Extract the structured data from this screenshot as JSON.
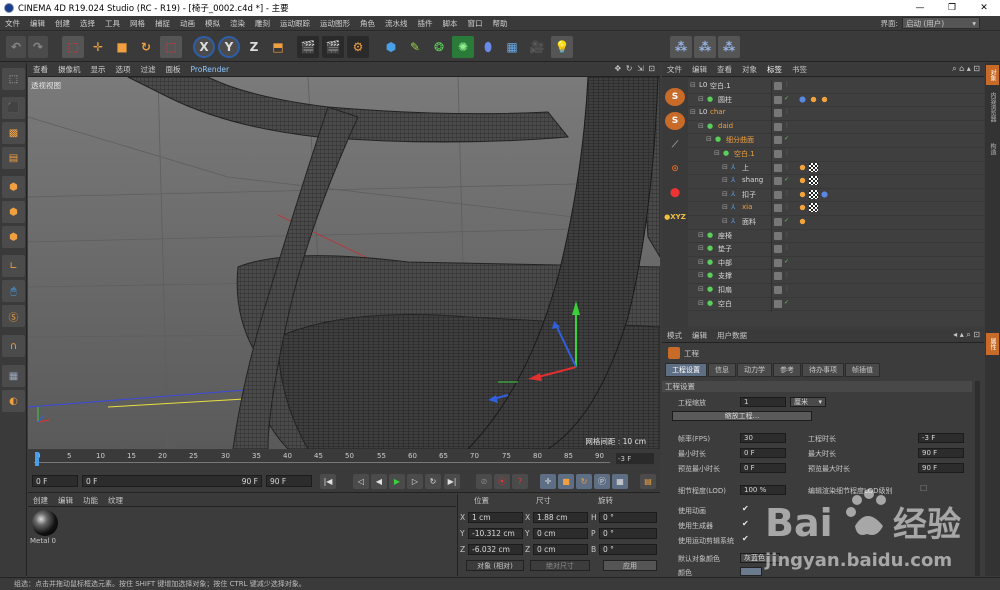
{
  "titlebar": {
    "title": "CINEMA 4D R19.024 Studio (RC - R19) - [椅子_0002.c4d *] - 主要",
    "min": "—",
    "max": "❐",
    "close": "✕"
  },
  "menubar": {
    "items": [
      "文件",
      "编辑",
      "创建",
      "选择",
      "工具",
      "网格",
      "捕捉",
      "动画",
      "模拟",
      "渲染",
      "雕刻",
      "运动跟踪",
      "运动图形",
      "角色",
      "流水线",
      "插件",
      "脚本",
      "窗口",
      "帮助"
    ],
    "layout_label": "界面:",
    "layout_value": "启动 (用户)"
  },
  "toolbar": {
    "x_label": "X",
    "y_label": "Y",
    "z_label": "Z"
  },
  "viewport": {
    "menu": [
      "查看",
      "摄像机",
      "显示",
      "选项",
      "过滤",
      "面板",
      "ProRender"
    ],
    "label": "透视视图",
    "grid_spacing": "网格间距 : 10 cm"
  },
  "timeline": {
    "ticks": [
      "0",
      "5",
      "10",
      "15",
      "20",
      "25",
      "30",
      "35",
      "40",
      "45",
      "50",
      "55",
      "60",
      "65",
      "70",
      "75",
      "80",
      "85",
      "90"
    ],
    "end_frame": "-3 F"
  },
  "playbar": {
    "start": "0 F",
    "current": "0 F",
    "range_end": "90 F",
    "end": "90 F"
  },
  "material_panel": {
    "menu": [
      "创建",
      "编辑",
      "功能",
      "纹理"
    ],
    "material_name": "Metal 0"
  },
  "coord_panel": {
    "headers": [
      "位置",
      "尺寸",
      "旋转"
    ],
    "rows": [
      {
        "axis": "X",
        "pos": "1 cm",
        "size_axis": "X",
        "size": "1.88 cm",
        "rot_axis": "H",
        "rot": "0 °"
      },
      {
        "axis": "Y",
        "pos": "-10.312 cm",
        "size_axis": "Y",
        "size": "0 cm",
        "rot_axis": "P",
        "rot": "0 °"
      },
      {
        "axis": "Z",
        "pos": "-6.032 cm",
        "size_axis": "Z",
        "size": "0 cm",
        "rot_axis": "B",
        "rot": "0 °"
      }
    ],
    "mode_object": "对象 (相对)",
    "mode_size": "绝对尺寸",
    "apply": "应用"
  },
  "status_text": "组选：点击并拖动鼠标框选元素。按住 SHIFT 键增加选择对象；按住 CTRL 键减少选择对象。",
  "object_manager": {
    "menu": [
      "文件",
      "编辑",
      "查看",
      "对象",
      "标签",
      "书签"
    ],
    "rows": [
      {
        "name": "空白.1",
        "indent": 0,
        "color": "#d8d8d8"
      },
      {
        "name": "圆柱",
        "indent": 1,
        "color": "#d8d8d8"
      },
      {
        "name": "char",
        "indent": 0,
        "color": "#f0a040"
      },
      {
        "name": "daid",
        "indent": 1,
        "color": "#f0a040"
      },
      {
        "name": "细分曲面",
        "indent": 2,
        "color": "#f0a040"
      },
      {
        "name": "空白.1",
        "indent": 3,
        "color": "#f0a040"
      },
      {
        "name": "上",
        "indent": 4,
        "color": "#d8d8d8"
      },
      {
        "name": "shang",
        "indent": 4,
        "color": "#d8d8d8"
      },
      {
        "name": "扣子",
        "indent": 4,
        "color": "#d8d8d8"
      },
      {
        "name": "xia",
        "indent": 4,
        "color": "#f0a040"
      },
      {
        "name": "面料",
        "indent": 4,
        "color": "#d8d8d8"
      },
      {
        "name": "座椅",
        "indent": 1,
        "color": "#d8d8d8"
      },
      {
        "name": "垫子",
        "indent": 1,
        "color": "#d8d8d8"
      },
      {
        "name": "中部",
        "indent": 1,
        "color": "#d8d8d8"
      },
      {
        "name": "支撑",
        "indent": 1,
        "color": "#d8d8d8"
      },
      {
        "name": "扣扇",
        "indent": 1,
        "color": "#d8d8d8"
      },
      {
        "name": "空白",
        "indent": 1,
        "color": "#d8d8d8"
      }
    ]
  },
  "right_strip": [
    "对象",
    "内容浏览器",
    "构造",
    "属性"
  ],
  "attributes": {
    "menu": [
      "模式",
      "编辑",
      "用户数据"
    ],
    "title": "工程",
    "tabs": [
      "工程设置",
      "信息",
      "动力学",
      "参考",
      "待办事项",
      "帧插值"
    ],
    "section": "工程设置",
    "scale_label": "工程缩放",
    "scale_value": "1",
    "scale_unit": "厘米",
    "scale_button": "缩放工程...",
    "fps_label": "帧率(FPS)",
    "fps_value": "30",
    "project_time_label": "工程时长",
    "project_time_value": "-3 F",
    "min_time_label": "最小时长",
    "min_time_value": "0 F",
    "max_time_label": "最大时长",
    "max_time_value": "90 F",
    "preview_min_label": "预览最小时长",
    "preview_min_value": "0 F",
    "preview_max_label": "预览最大时长",
    "preview_max_value": "90 F",
    "lod_label": "细节程度(LOD)",
    "lod_value": "100 %",
    "render_lod_label": "编辑渲染细节程度LOD级别",
    "use_anim_label": "使用动画",
    "use_gen_label": "使用生成器",
    "use_motion_label": "使用运动剪辑系统",
    "default_color_label": "默认对象颜色",
    "default_color_value": "灰蓝色",
    "color_label": "颜色",
    "check": "✔"
  },
  "colors": {
    "accent_orange": "#f0a040",
    "active_tab": "#5e6f85",
    "viewport_bg": "#6f6f6f"
  }
}
